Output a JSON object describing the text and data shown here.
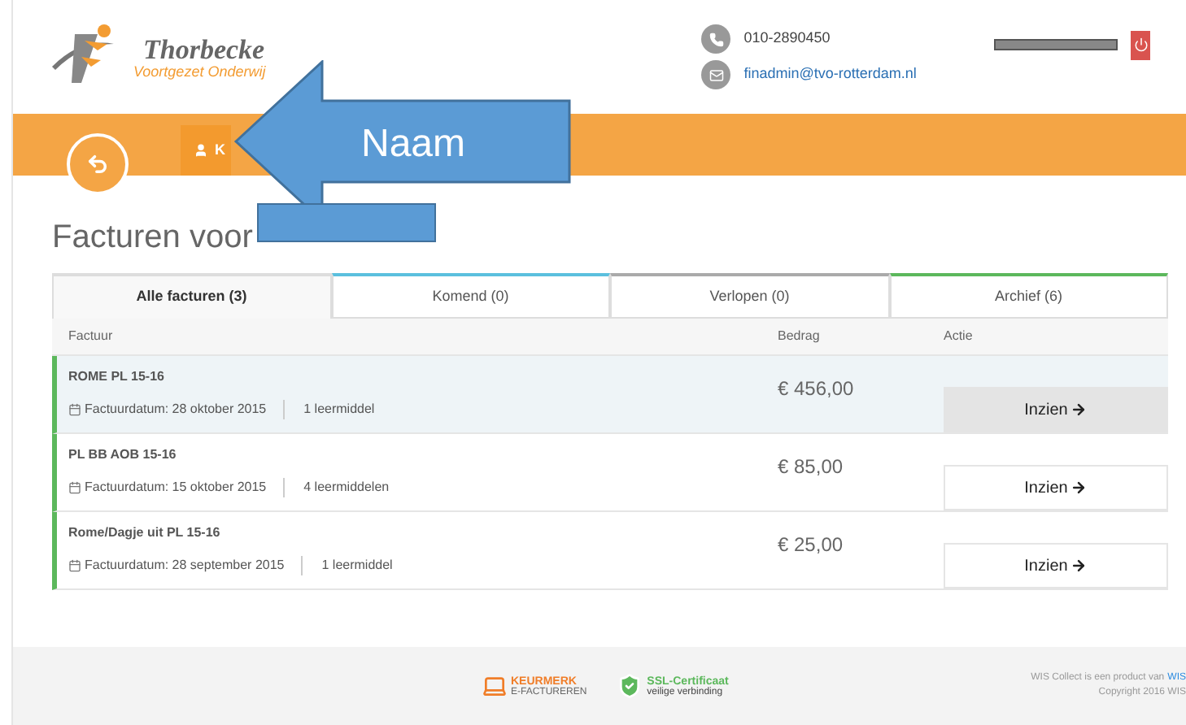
{
  "header": {
    "logo_name": "Thorbecke",
    "logo_tagline": "Voortgezet Onderwij",
    "phone": "010-2890450",
    "email": "finadmin@tvo-rotterdam.nl"
  },
  "nav": {
    "tab_label": "K"
  },
  "annotation": {
    "label": "Naam"
  },
  "title": "Facturen voor",
  "tabs": [
    {
      "label": "Alle facturen (3)",
      "selected": true,
      "color": "#dddddd"
    },
    {
      "label": "Komend (0)",
      "selected": false,
      "color": "#5bc0de"
    },
    {
      "label": "Verlopen (0)",
      "selected": false,
      "color": "#aaaaaa"
    },
    {
      "label": "Archief (6)",
      "selected": false,
      "color": "#5cb85c"
    }
  ],
  "table": {
    "columns": [
      "Factuur",
      "Bedrag",
      "Actie"
    ],
    "rows": [
      {
        "name": "ROME PL 15-16",
        "date": "Factuurdatum: 28 oktober 2015",
        "count": "1 leermiddel",
        "amount": "€ 456,00",
        "action": "Inzien",
        "selected": true
      },
      {
        "name": "PL BB AOB 15-16",
        "date": "Factuurdatum: 15 oktober 2015",
        "count": "4 leermiddelen",
        "amount": "€ 85,00",
        "action": "Inzien",
        "selected": false
      },
      {
        "name": "Rome/Dagje uit PL 15-16",
        "date": "Factuurdatum: 28 september 2015",
        "count": "1 leermiddel",
        "amount": "€ 25,00",
        "action": "Inzien",
        "selected": false
      }
    ]
  },
  "footer": {
    "keurmerk": [
      "KEURMERK",
      "E-FACTUREREN"
    ],
    "ssl": [
      "SSL-Certificaat",
      "veilige verbinding"
    ],
    "product_text": "WIS Collect is een product van",
    "product_link": "WIS",
    "copyright": "Copyright 2016 WIS"
  }
}
